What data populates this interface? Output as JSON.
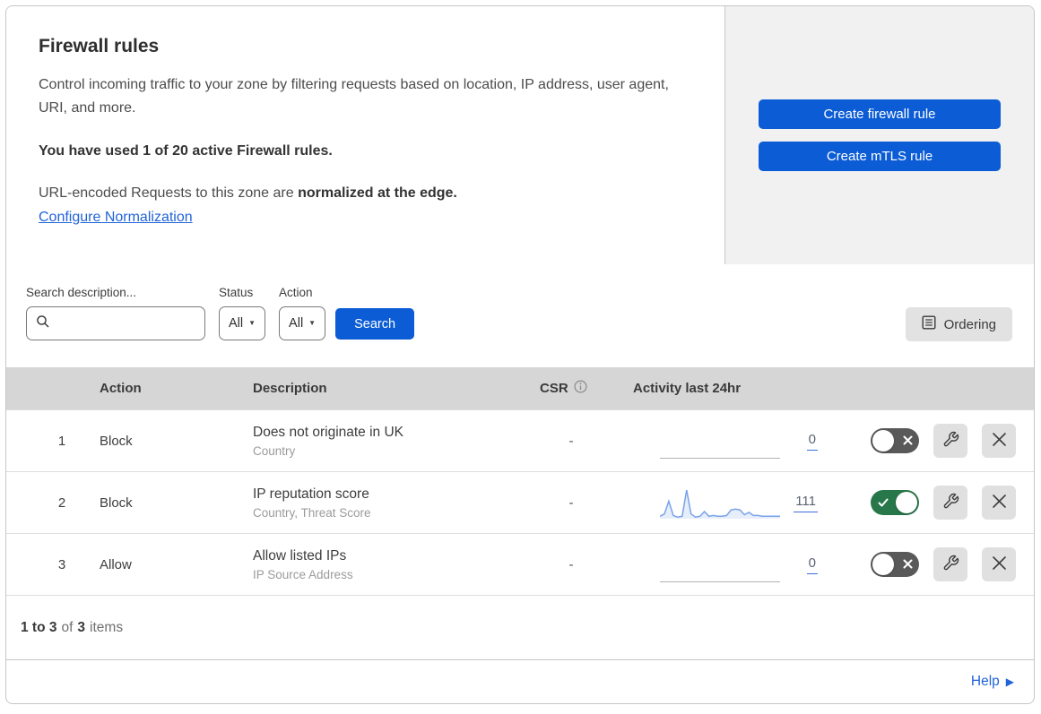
{
  "colors": {
    "accent_blue": "#0b5cd5",
    "link_blue": "#2264d8",
    "toggle_on_green": "#27774a",
    "toggle_off_gray": "#595959",
    "sparkline_blue": "#7aa3e8",
    "table_header_gray": "#d6d6d6",
    "side_panel_gray": "#f1f1f1"
  },
  "header": {
    "title": "Firewall rules",
    "description": "Control incoming traffic to your zone by filtering requests based on location, IP address, user agent, URI, and more.",
    "usage": "You have used 1 of 20 active Firewall rules.",
    "normalization_prefix": "URL-encoded Requests to this zone are",
    "normalization_bold": "normalized at the edge.",
    "normalization_link": "Configure Normalization",
    "create_firewall_button": "Create firewall rule",
    "create_mtls_button": "Create mTLS rule"
  },
  "filters": {
    "search_label": "Search description...",
    "search_value": "",
    "status_label": "Status",
    "status_value": "All",
    "action_label": "Action",
    "action_value": "All",
    "search_button": "Search",
    "ordering_button": "Ordering"
  },
  "table": {
    "columns": {
      "action": "Action",
      "description": "Description",
      "csr": "CSR",
      "activity": "Activity last 24hr"
    },
    "rows": [
      {
        "index": "1",
        "action": "Block",
        "description": "Does not originate in UK",
        "fields": "Country",
        "csr": "-",
        "activity_count": "0",
        "enabled": false,
        "sparkline": null
      },
      {
        "index": "2",
        "action": "Block",
        "description": "IP reputation score",
        "fields": "Country, Threat Score",
        "csr": "-",
        "activity_count": "111",
        "enabled": true,
        "sparkline": [
          3,
          6,
          22,
          4,
          2,
          3,
          36,
          6,
          2,
          3,
          9,
          3,
          4,
          3,
          3,
          4,
          11,
          12,
          11,
          5,
          8,
          4,
          4,
          3,
          3,
          3,
          3,
          3
        ]
      },
      {
        "index": "3",
        "action": "Allow",
        "description": "Allow listed IPs",
        "fields": "IP Source Address",
        "csr": "-",
        "activity_count": "0",
        "enabled": false,
        "sparkline": null
      }
    ]
  },
  "footer": {
    "range": "1 to 3",
    "of_label": "of",
    "total": "3",
    "items_label": "items",
    "help_label": "Help"
  }
}
